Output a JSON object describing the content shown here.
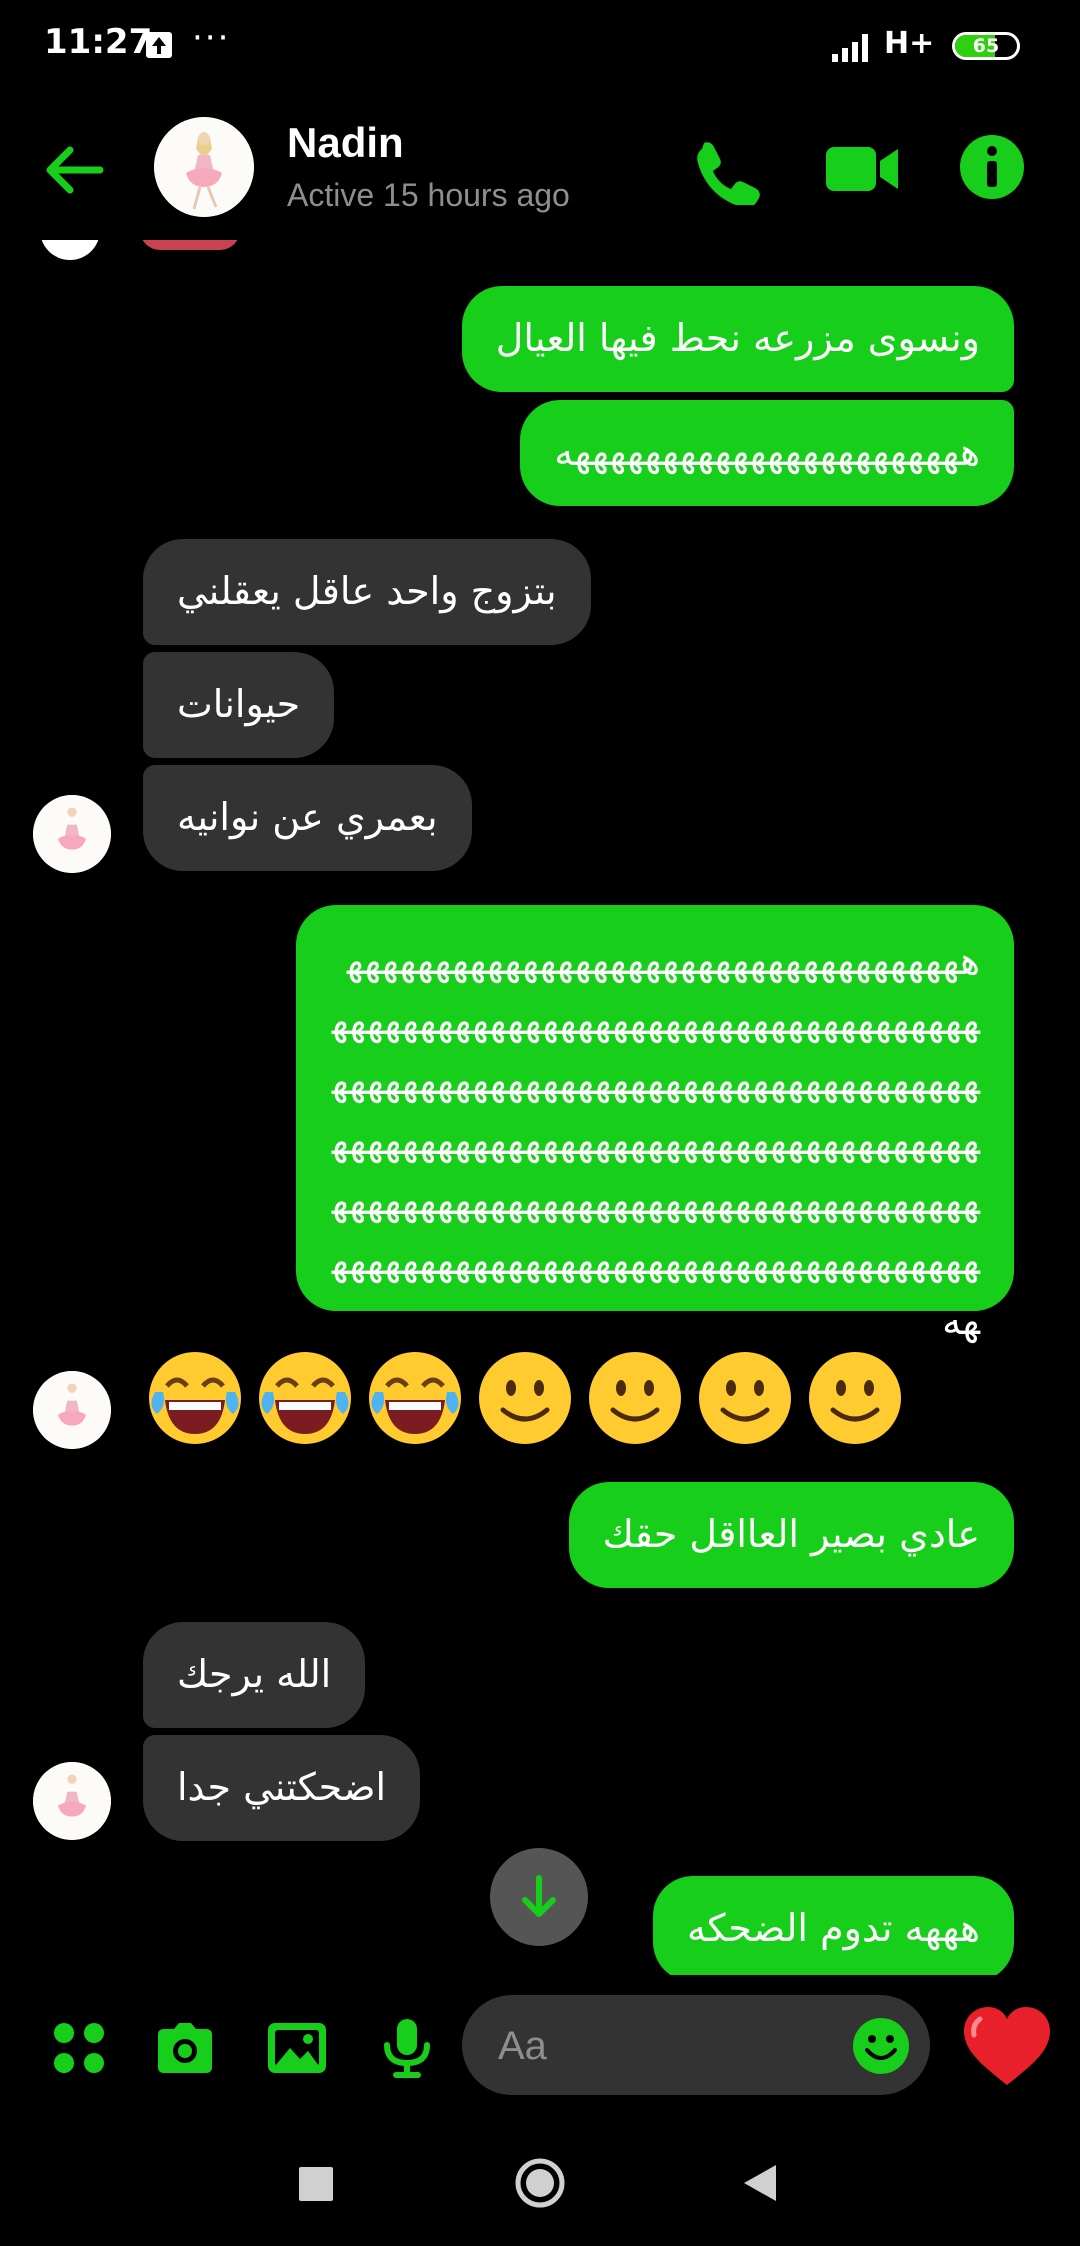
{
  "status_bar": {
    "time": "11:27",
    "network": "H+",
    "battery": "65",
    "battery_level": 0.65
  },
  "header": {
    "contact_name": "Nadin",
    "active_status": "Active 15 hours ago",
    "accent_color": "#17cf1a"
  },
  "messages": {
    "out_1": "ونسوى مزرعه نحط فيها العيال",
    "out_2": "هههههههههههههههههههههههه",
    "in_1": "بتزوج واحد عاقل يعقلني",
    "in_2": "حيوانات",
    "in_3": "بعمري عن نوانيه",
    "out_3": "ههههههههههههههههههههههههههههههههههههههههههههههههههههههههههههههههههههههههههههههههههههههههههههههههههههههههههههههههههههههههههههههههههههههههههههههههههههههههههههههههههههههههههههههههههههههههههههههههههههههههههههههههههههههههههههههه",
    "emoji_message": [
      "joy",
      "joy",
      "joy",
      "slightly-smiling",
      "slightly-smiling",
      "slightly-smiling",
      "slightly-smiling"
    ],
    "out_4": "عادي بصير العااقل حقك",
    "in_4": "الله يرجك",
    "in_5": "اضحكتني جدا",
    "out_5": "هههه تدوم الضحكه"
  },
  "composer": {
    "placeholder": "Aa"
  },
  "colors": {
    "outgoing_bubble": "#17cf1a",
    "incoming_bubble": "#333333",
    "background": "#000000"
  }
}
